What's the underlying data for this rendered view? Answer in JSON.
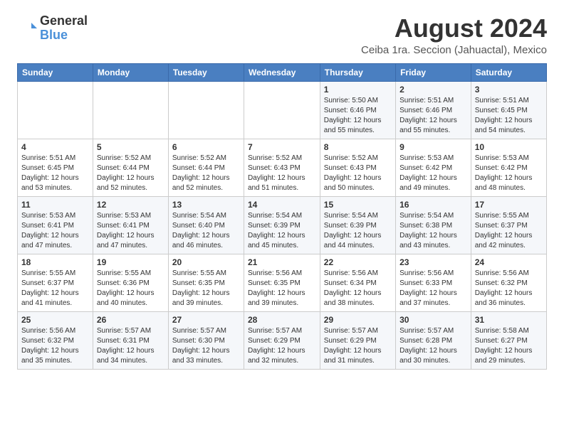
{
  "header": {
    "logo_general": "General",
    "logo_blue": "Blue",
    "month_title": "August 2024",
    "location": "Ceiba 1ra. Seccion (Jahuactal), Mexico"
  },
  "weekdays": [
    "Sunday",
    "Monday",
    "Tuesday",
    "Wednesday",
    "Thursday",
    "Friday",
    "Saturday"
  ],
  "weeks": [
    [
      {
        "day": "",
        "info": ""
      },
      {
        "day": "",
        "info": ""
      },
      {
        "day": "",
        "info": ""
      },
      {
        "day": "",
        "info": ""
      },
      {
        "day": "1",
        "info": "Sunrise: 5:50 AM\nSunset: 6:46 PM\nDaylight: 12 hours\nand 55 minutes."
      },
      {
        "day": "2",
        "info": "Sunrise: 5:51 AM\nSunset: 6:46 PM\nDaylight: 12 hours\nand 55 minutes."
      },
      {
        "day": "3",
        "info": "Sunrise: 5:51 AM\nSunset: 6:45 PM\nDaylight: 12 hours\nand 54 minutes."
      }
    ],
    [
      {
        "day": "4",
        "info": "Sunrise: 5:51 AM\nSunset: 6:45 PM\nDaylight: 12 hours\nand 53 minutes."
      },
      {
        "day": "5",
        "info": "Sunrise: 5:52 AM\nSunset: 6:44 PM\nDaylight: 12 hours\nand 52 minutes."
      },
      {
        "day": "6",
        "info": "Sunrise: 5:52 AM\nSunset: 6:44 PM\nDaylight: 12 hours\nand 52 minutes."
      },
      {
        "day": "7",
        "info": "Sunrise: 5:52 AM\nSunset: 6:43 PM\nDaylight: 12 hours\nand 51 minutes."
      },
      {
        "day": "8",
        "info": "Sunrise: 5:52 AM\nSunset: 6:43 PM\nDaylight: 12 hours\nand 50 minutes."
      },
      {
        "day": "9",
        "info": "Sunrise: 5:53 AM\nSunset: 6:42 PM\nDaylight: 12 hours\nand 49 minutes."
      },
      {
        "day": "10",
        "info": "Sunrise: 5:53 AM\nSunset: 6:42 PM\nDaylight: 12 hours\nand 48 minutes."
      }
    ],
    [
      {
        "day": "11",
        "info": "Sunrise: 5:53 AM\nSunset: 6:41 PM\nDaylight: 12 hours\nand 47 minutes."
      },
      {
        "day": "12",
        "info": "Sunrise: 5:53 AM\nSunset: 6:41 PM\nDaylight: 12 hours\nand 47 minutes."
      },
      {
        "day": "13",
        "info": "Sunrise: 5:54 AM\nSunset: 6:40 PM\nDaylight: 12 hours\nand 46 minutes."
      },
      {
        "day": "14",
        "info": "Sunrise: 5:54 AM\nSunset: 6:39 PM\nDaylight: 12 hours\nand 45 minutes."
      },
      {
        "day": "15",
        "info": "Sunrise: 5:54 AM\nSunset: 6:39 PM\nDaylight: 12 hours\nand 44 minutes."
      },
      {
        "day": "16",
        "info": "Sunrise: 5:54 AM\nSunset: 6:38 PM\nDaylight: 12 hours\nand 43 minutes."
      },
      {
        "day": "17",
        "info": "Sunrise: 5:55 AM\nSunset: 6:37 PM\nDaylight: 12 hours\nand 42 minutes."
      }
    ],
    [
      {
        "day": "18",
        "info": "Sunrise: 5:55 AM\nSunset: 6:37 PM\nDaylight: 12 hours\nand 41 minutes."
      },
      {
        "day": "19",
        "info": "Sunrise: 5:55 AM\nSunset: 6:36 PM\nDaylight: 12 hours\nand 40 minutes."
      },
      {
        "day": "20",
        "info": "Sunrise: 5:55 AM\nSunset: 6:35 PM\nDaylight: 12 hours\nand 39 minutes."
      },
      {
        "day": "21",
        "info": "Sunrise: 5:56 AM\nSunset: 6:35 PM\nDaylight: 12 hours\nand 39 minutes."
      },
      {
        "day": "22",
        "info": "Sunrise: 5:56 AM\nSunset: 6:34 PM\nDaylight: 12 hours\nand 38 minutes."
      },
      {
        "day": "23",
        "info": "Sunrise: 5:56 AM\nSunset: 6:33 PM\nDaylight: 12 hours\nand 37 minutes."
      },
      {
        "day": "24",
        "info": "Sunrise: 5:56 AM\nSunset: 6:32 PM\nDaylight: 12 hours\nand 36 minutes."
      }
    ],
    [
      {
        "day": "25",
        "info": "Sunrise: 5:56 AM\nSunset: 6:32 PM\nDaylight: 12 hours\nand 35 minutes."
      },
      {
        "day": "26",
        "info": "Sunrise: 5:57 AM\nSunset: 6:31 PM\nDaylight: 12 hours\nand 34 minutes."
      },
      {
        "day": "27",
        "info": "Sunrise: 5:57 AM\nSunset: 6:30 PM\nDaylight: 12 hours\nand 33 minutes."
      },
      {
        "day": "28",
        "info": "Sunrise: 5:57 AM\nSunset: 6:29 PM\nDaylight: 12 hours\nand 32 minutes."
      },
      {
        "day": "29",
        "info": "Sunrise: 5:57 AM\nSunset: 6:29 PM\nDaylight: 12 hours\nand 31 minutes."
      },
      {
        "day": "30",
        "info": "Sunrise: 5:57 AM\nSunset: 6:28 PM\nDaylight: 12 hours\nand 30 minutes."
      },
      {
        "day": "31",
        "info": "Sunrise: 5:58 AM\nSunset: 6:27 PM\nDaylight: 12 hours\nand 29 minutes."
      }
    ]
  ]
}
